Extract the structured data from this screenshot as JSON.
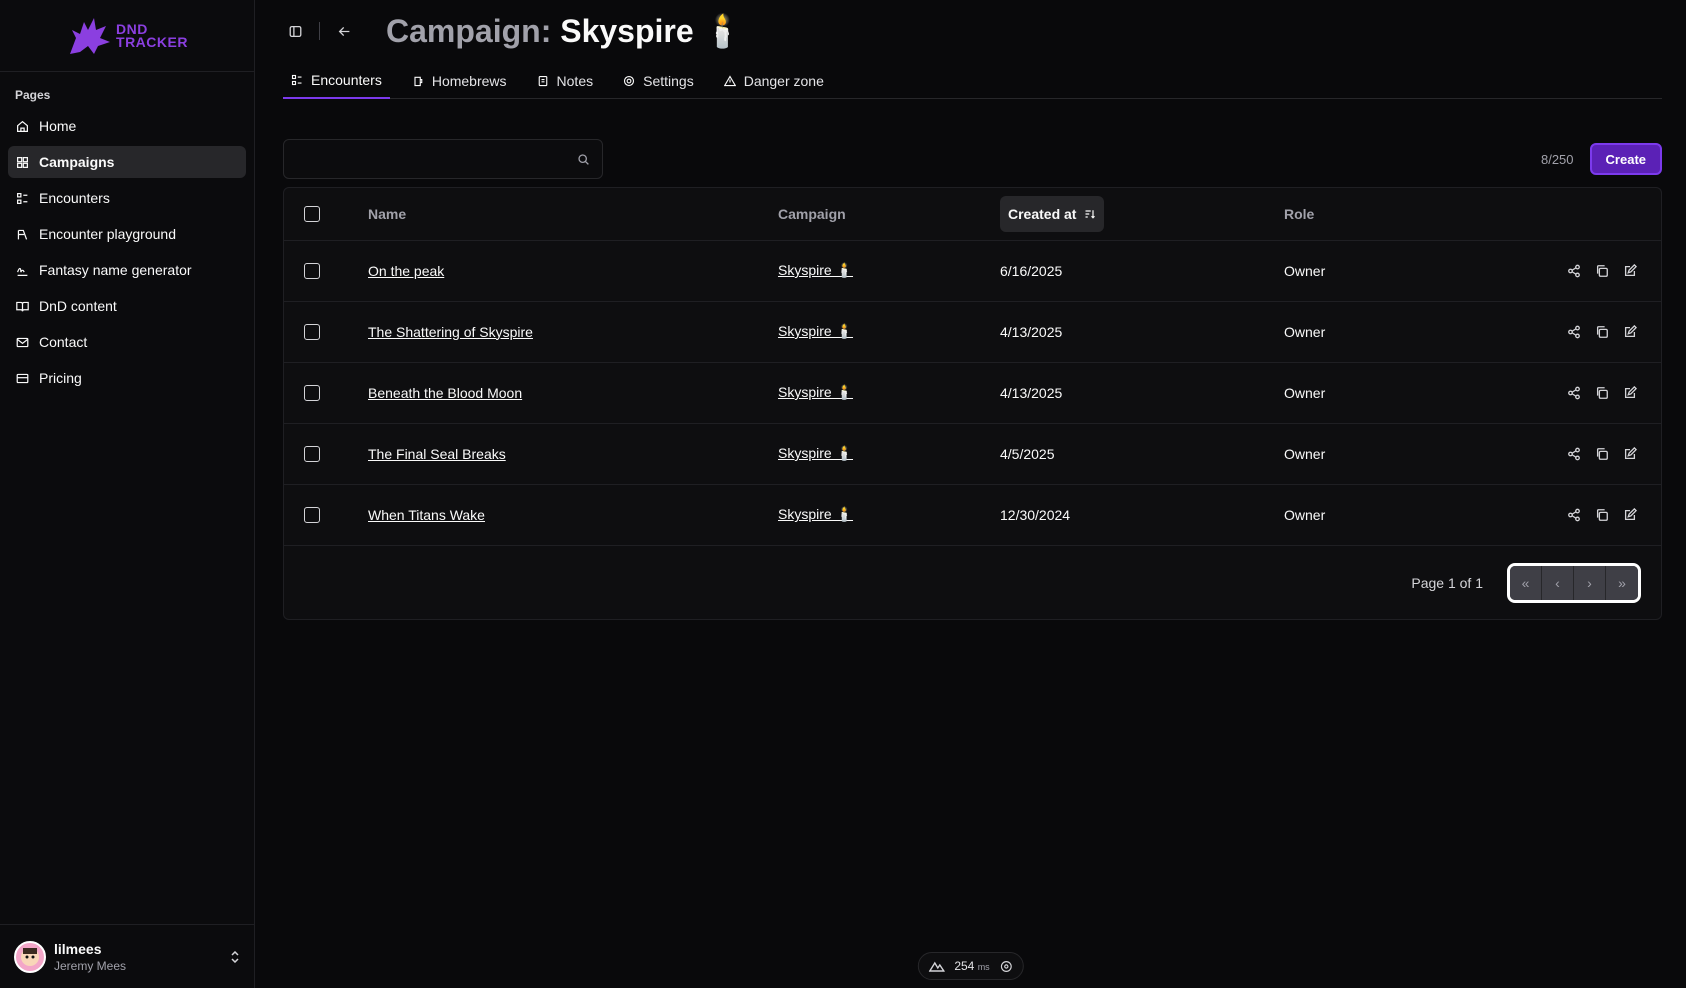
{
  "brand": {
    "line1": "DND",
    "line2": "TRACKER",
    "color": "#8b3fe0"
  },
  "sidebar": {
    "section_label": "Pages",
    "items": [
      {
        "label": "Home",
        "icon": "home-icon"
      },
      {
        "label": "Campaigns",
        "icon": "grid-icon",
        "active": true
      },
      {
        "label": "Encounters",
        "icon": "list-icon"
      },
      {
        "label": "Encounter playground",
        "icon": "playground-icon"
      },
      {
        "label": "Fantasy name generator",
        "icon": "signature-icon"
      },
      {
        "label": "DnD content",
        "icon": "book-icon"
      },
      {
        "label": "Contact",
        "icon": "mail-icon"
      },
      {
        "label": "Pricing",
        "icon": "card-icon"
      }
    ]
  },
  "user": {
    "username": "lilmees",
    "full_name": "Jeremy Mees"
  },
  "header": {
    "title_prefix": "Campaign:",
    "title_name": "Skyspire 🕯️"
  },
  "tabs": [
    {
      "label": "Encounters",
      "icon": "list-icon",
      "active": true
    },
    {
      "label": "Homebrews",
      "icon": "beer-icon"
    },
    {
      "label": "Notes",
      "icon": "note-icon"
    },
    {
      "label": "Settings",
      "icon": "gear-icon"
    },
    {
      "label": "Danger zone",
      "icon": "warning-icon"
    }
  ],
  "toolbar": {
    "search_placeholder": "",
    "count": "8/250",
    "create_label": "Create"
  },
  "table": {
    "columns": {
      "name": "Name",
      "campaign": "Campaign",
      "created": "Created at",
      "role": "Role"
    },
    "rows": [
      {
        "name": "On the peak",
        "campaign": "Skyspire 🕯️",
        "created": "6/16/2025",
        "role": "Owner"
      },
      {
        "name": "The Shattering of Skyspire",
        "campaign": "Skyspire 🕯️",
        "created": "4/13/2025",
        "role": "Owner"
      },
      {
        "name": "Beneath the Blood Moon",
        "campaign": "Skyspire 🕯️",
        "created": "4/13/2025",
        "role": "Owner"
      },
      {
        "name": "The Final Seal Breaks",
        "campaign": "Skyspire 🕯️",
        "created": "4/5/2025",
        "role": "Owner"
      },
      {
        "name": "When Titans Wake",
        "campaign": "Skyspire 🕯️",
        "created": "12/30/2024",
        "role": "Owner"
      }
    ]
  },
  "pagination": {
    "label": "Page 1 of 1"
  },
  "perf": {
    "value": "254",
    "unit": "ms"
  },
  "colors": {
    "accent": "#7c3aed",
    "background": "#09090b"
  }
}
